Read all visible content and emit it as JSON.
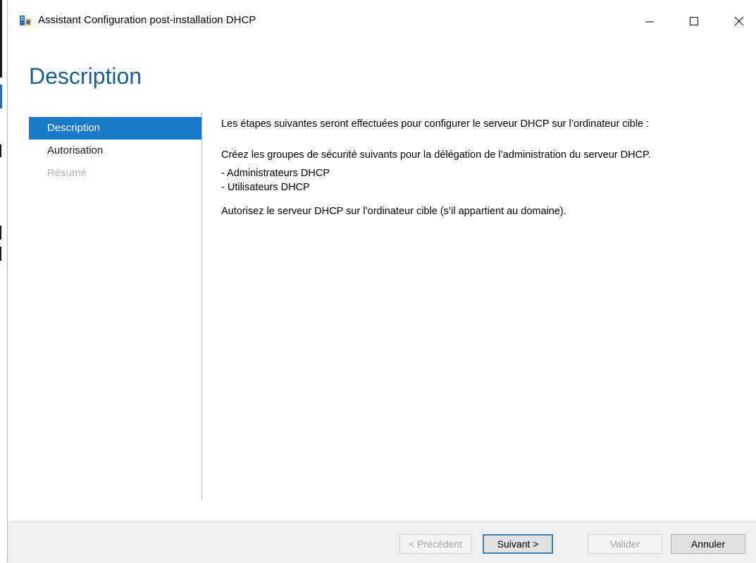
{
  "window": {
    "title": "Assistant Configuration post-installation DHCP",
    "controls": [
      "minimize-icon",
      "maximize-icon",
      "close-icon"
    ]
  },
  "page": {
    "heading": "Description"
  },
  "nav": {
    "items": [
      {
        "label": "Description",
        "state": "active"
      },
      {
        "label": "Autorisation",
        "state": "normal"
      },
      {
        "label": "Résumé",
        "state": "disabled"
      }
    ]
  },
  "content": {
    "intro": "Les étapes suivantes seront effectuées pour configurer le serveur DHCP sur l’ordinateur cible :",
    "groups_text": "Créez les groupes de sécurité suivants pour la délégation de l’administration du serveur DHCP.",
    "groups": [
      "- Administrateurs DHCP",
      "- Utilisateurs DHCP"
    ],
    "authorize_text": "Autorisez le serveur DHCP sur l’ordinateur cible (s’il appartient au domaine)."
  },
  "footer": {
    "previous": "< Précédent",
    "next": "Suivant >",
    "validate": "Valider",
    "cancel": "Annuler"
  },
  "colors": {
    "heading": "#1e5f8a",
    "nav_active_bg": "#1979ca",
    "footer_bg": "#f0f0f0"
  }
}
